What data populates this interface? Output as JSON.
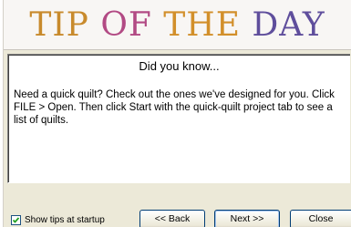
{
  "banner": {
    "title_words": [
      "TIP",
      "OF",
      "THE",
      "DAY"
    ]
  },
  "tip": {
    "heading": "Did you know...",
    "body": "Need a quick quilt? Check out the ones we've designed for you. Click FILE > Open. Then click Start with the quick-quilt project tab to see a list of quilts."
  },
  "footer": {
    "show_tips_label": "Show tips at startup",
    "show_tips_checked": true,
    "back_label": "<< Back",
    "next_label": "Next >>",
    "close_label": "Close"
  },
  "colors": {
    "title_tip": "#c88a2c",
    "title_of": "#b24a84",
    "title_the": "#d28f2a",
    "title_day": "#5f4e9c"
  }
}
